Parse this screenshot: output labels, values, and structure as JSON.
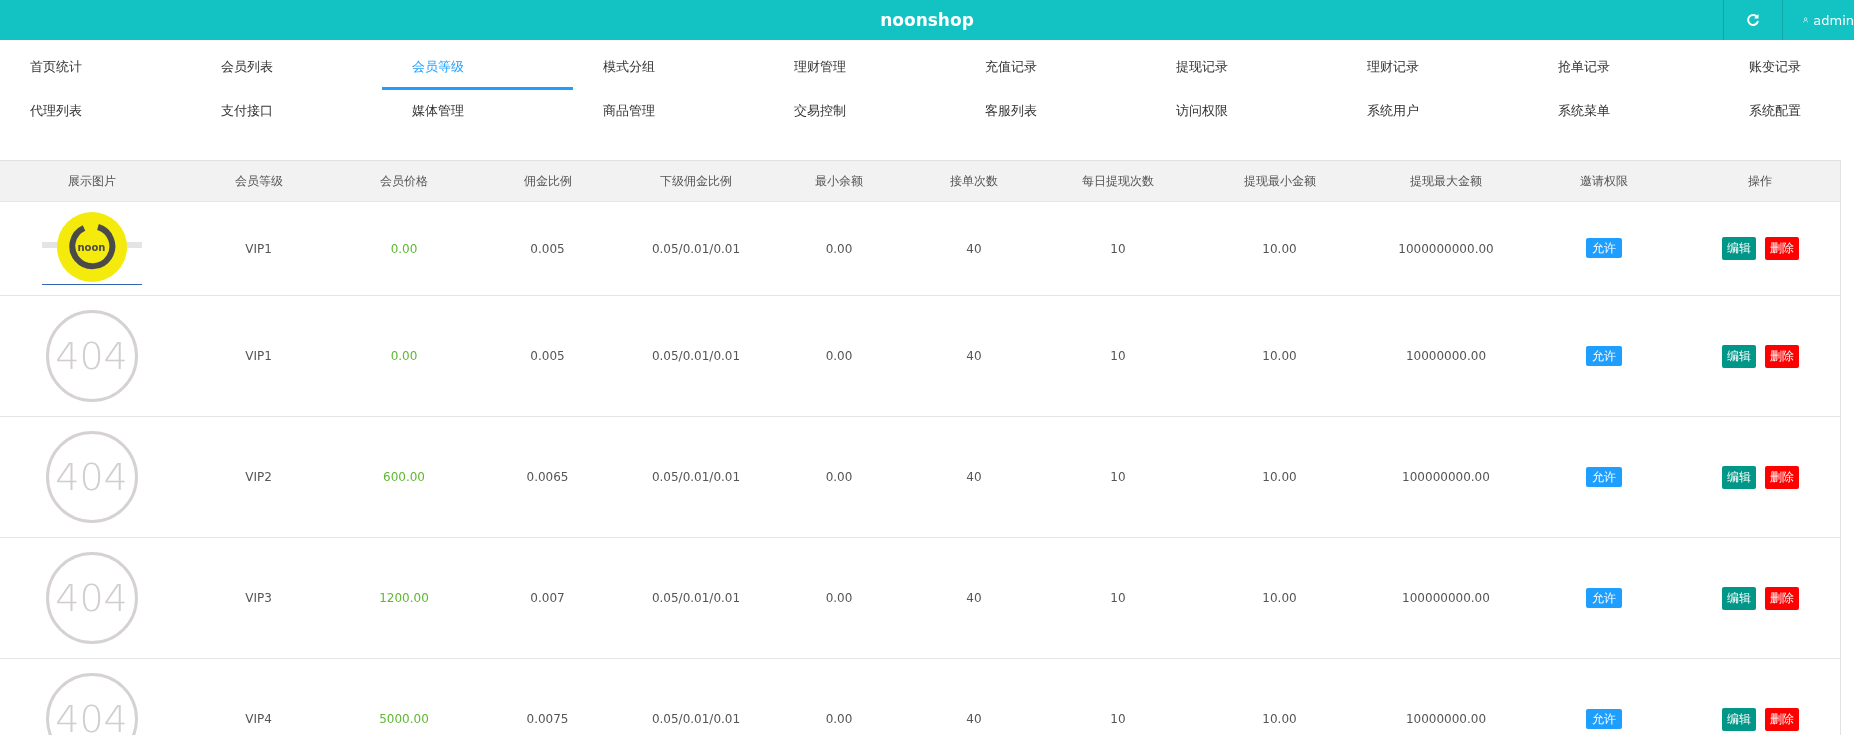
{
  "header": {
    "title": "noonshop",
    "user": "admin"
  },
  "nav": [
    {
      "label": "首页统计",
      "selected": false
    },
    {
      "label": "会员列表",
      "selected": false
    },
    {
      "label": "会员等级",
      "selected": true
    },
    {
      "label": "模式分组",
      "selected": false
    },
    {
      "label": "理财管理",
      "selected": false
    },
    {
      "label": "充值记录",
      "selected": false
    },
    {
      "label": "提现记录",
      "selected": false
    },
    {
      "label": "理财记录",
      "selected": false
    },
    {
      "label": "抢单记录",
      "selected": false
    },
    {
      "label": "账变记录",
      "selected": false
    },
    {
      "label": "代理列表",
      "selected": false
    },
    {
      "label": "支付接口",
      "selected": false
    },
    {
      "label": "媒体管理",
      "selected": false
    },
    {
      "label": "商品管理",
      "selected": false
    },
    {
      "label": "交易控制",
      "selected": false
    },
    {
      "label": "客服列表",
      "selected": false
    },
    {
      "label": "访问权限",
      "selected": false
    },
    {
      "label": "系统用户",
      "selected": false
    },
    {
      "label": "系统菜单",
      "selected": false
    },
    {
      "label": "系统配置",
      "selected": false
    }
  ],
  "table": {
    "columns": [
      "展示图片",
      "会员等级",
      "会员价格",
      "佣金比例",
      "下级佣金比例",
      "最小余额",
      "接单次数",
      "每日提现次数",
      "提现最小金额",
      "提现最大金额",
      "邀请权限",
      "操作"
    ],
    "rows": [
      {
        "image": {
          "kind": "logo",
          "text": "noon"
        },
        "level": "VIP1",
        "price": "0.00",
        "commission": "0.005",
        "sub_commission": "0.05/0.01/0.01",
        "min_balance": "0.00",
        "orders": "40",
        "daily_withdrawals": "10",
        "withdraw_min": "10.00",
        "withdraw_max": "1000000000.00",
        "invite": "允许",
        "actions": [
          "编辑",
          "删除"
        ]
      },
      {
        "image": {
          "kind": "missing",
          "text": "404"
        },
        "level": "VIP1",
        "price": "0.00",
        "commission": "0.005",
        "sub_commission": "0.05/0.01/0.01",
        "min_balance": "0.00",
        "orders": "40",
        "daily_withdrawals": "10",
        "withdraw_min": "10.00",
        "withdraw_max": "10000000.00",
        "invite": "允许",
        "actions": [
          "编辑",
          "删除"
        ]
      },
      {
        "image": {
          "kind": "missing",
          "text": "404"
        },
        "level": "VIP2",
        "price": "600.00",
        "commission": "0.0065",
        "sub_commission": "0.05/0.01/0.01",
        "min_balance": "0.00",
        "orders": "40",
        "daily_withdrawals": "10",
        "withdraw_min": "10.00",
        "withdraw_max": "100000000.00",
        "invite": "允许",
        "actions": [
          "编辑",
          "删除"
        ]
      },
      {
        "image": {
          "kind": "missing",
          "text": "404"
        },
        "level": "VIP3",
        "price": "1200.00",
        "commission": "0.007",
        "sub_commission": "0.05/0.01/0.01",
        "min_balance": "0.00",
        "orders": "40",
        "daily_withdrawals": "10",
        "withdraw_min": "10.00",
        "withdraw_max": "100000000.00",
        "invite": "允许",
        "actions": [
          "编辑",
          "删除"
        ]
      },
      {
        "image": {
          "kind": "missing",
          "text": "404"
        },
        "level": "VIP4",
        "price": "5000.00",
        "commission": "0.0075",
        "sub_commission": "0.05/0.01/0.01",
        "min_balance": "0.00",
        "orders": "40",
        "daily_withdrawals": "10",
        "withdraw_min": "10.00",
        "withdraw_max": "10000000.00",
        "invite": "允许",
        "actions": [
          "编辑",
          "删除"
        ]
      }
    ]
  }
}
